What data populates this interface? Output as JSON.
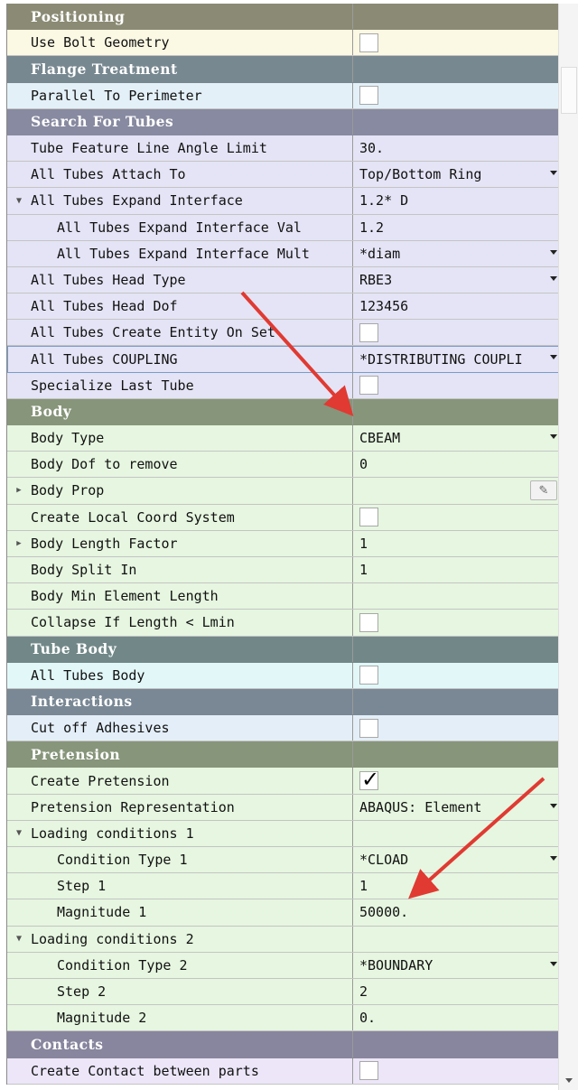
{
  "colors": {
    "positioning": {
      "header": "#8b8b75",
      "row": "#fbf8e3"
    },
    "flange": {
      "header": "#788890",
      "row": "#e3f0f8"
    },
    "search": {
      "header": "#878aa0",
      "row": "#e4e4f6"
    },
    "body": {
      "header": "#87957a",
      "row": "#e6f6e0"
    },
    "tubebody": {
      "header": "#728888",
      "row": "#e2f8f8"
    },
    "interactions": {
      "header": "#7a8895",
      "row": "#e3eef8"
    },
    "pretension": {
      "header": "#87957a",
      "row": "#e6f6e0"
    },
    "contacts": {
      "header": "#88869e",
      "row": "#ece6f8"
    },
    "arrow": "#e03a32"
  },
  "rows": [
    {
      "label": "Positioning",
      "type": "header",
      "group": "positioning"
    },
    {
      "label": "Use Bolt Geometry",
      "group": "positioning",
      "kind": "checkbox",
      "checked": false
    },
    {
      "label": "Flange Treatment",
      "type": "header",
      "group": "flange"
    },
    {
      "label": "Parallel To Perimeter",
      "group": "flange",
      "kind": "checkbox",
      "checked": false
    },
    {
      "label": "Search For Tubes",
      "type": "header",
      "group": "search"
    },
    {
      "label": "Tube Feature Line Angle Limit",
      "group": "search",
      "kind": "text",
      "value": "30."
    },
    {
      "label": "All Tubes Attach To",
      "group": "search",
      "kind": "dropdown",
      "value": "Top/Bottom Ring"
    },
    {
      "label": "All Tubes Expand Interface",
      "group": "search",
      "kind": "text",
      "value": "1.2* D",
      "expander": "expanded"
    },
    {
      "label": "All Tubes Expand Interface Val",
      "group": "search",
      "kind": "text",
      "value": "1.2",
      "indent": true
    },
    {
      "label": "All Tubes Expand Interface Mult",
      "group": "search",
      "kind": "dropdown",
      "value": "*diam",
      "indent": true
    },
    {
      "label": "All Tubes Head Type",
      "group": "search",
      "kind": "dropdown",
      "value": "RBE3"
    },
    {
      "label": "All Tubes Head Dof",
      "group": "search",
      "kind": "text",
      "value": "123456"
    },
    {
      "label": "All Tubes Create Entity On Set",
      "group": "search",
      "kind": "checkbox",
      "checked": false
    },
    {
      "label": "All Tubes COUPLING",
      "group": "search",
      "kind": "dropdown",
      "value": "*DISTRIBUTING COUPLI",
      "selected": true
    },
    {
      "label": "Specialize Last Tube",
      "group": "search",
      "kind": "checkbox",
      "checked": false
    },
    {
      "label": "Body",
      "type": "header",
      "group": "body"
    },
    {
      "label": "Body Type",
      "group": "body",
      "kind": "dropdown",
      "value": "CBEAM"
    },
    {
      "label": "Body Dof to remove",
      "group": "body",
      "kind": "text",
      "value": "0"
    },
    {
      "label": "Body Prop",
      "group": "body",
      "kind": "button",
      "value": "",
      "expander": "collapsed"
    },
    {
      "label": "Create Local Coord System",
      "group": "body",
      "kind": "checkbox",
      "checked": false
    },
    {
      "label": "Body Length Factor",
      "group": "body",
      "kind": "text",
      "value": "1",
      "expander": "collapsed"
    },
    {
      "label": "Body Split In",
      "group": "body",
      "kind": "text",
      "value": "1"
    },
    {
      "label": "Body Min Element Length",
      "group": "body",
      "kind": "text",
      "value": ""
    },
    {
      "label": "Collapse If Length < Lmin",
      "group": "body",
      "kind": "checkbox",
      "checked": false
    },
    {
      "label": "Tube Body",
      "type": "header",
      "group": "tubebody"
    },
    {
      "label": "All Tubes Body",
      "group": "tubebody",
      "kind": "checkbox",
      "checked": false
    },
    {
      "label": "Interactions",
      "type": "header",
      "group": "interactions"
    },
    {
      "label": "Cut off Adhesives",
      "group": "interactions",
      "kind": "checkbox",
      "checked": false
    },
    {
      "label": "Pretension",
      "type": "header",
      "group": "pretension"
    },
    {
      "label": "Create Pretension",
      "group": "pretension",
      "kind": "checkbox",
      "checked": true
    },
    {
      "label": "Pretension Representation",
      "group": "pretension",
      "kind": "dropdown",
      "value": "ABAQUS: Element"
    },
    {
      "label": "Loading conditions 1",
      "group": "pretension",
      "kind": "text",
      "value": "",
      "expander": "expanded"
    },
    {
      "label": "Condition Type 1",
      "group": "pretension",
      "kind": "dropdown",
      "value": "*CLOAD",
      "indent": true
    },
    {
      "label": "Step 1",
      "group": "pretension",
      "kind": "text",
      "value": "1",
      "indent": true
    },
    {
      "label": "Magnitude 1",
      "group": "pretension",
      "kind": "text",
      "value": "50000.",
      "indent": true
    },
    {
      "label": "Loading conditions 2",
      "group": "pretension",
      "kind": "text",
      "value": "",
      "expander": "expanded"
    },
    {
      "label": "Condition Type 2",
      "group": "pretension",
      "kind": "dropdown",
      "value": "*BOUNDARY",
      "indent": true
    },
    {
      "label": "Step 2",
      "group": "pretension",
      "kind": "text",
      "value": "2",
      "indent": true
    },
    {
      "label": "Magnitude 2",
      "group": "pretension",
      "kind": "text",
      "value": "0.",
      "indent": true
    },
    {
      "label": "Contacts",
      "type": "header",
      "group": "contacts"
    },
    {
      "label": "Create Contact between parts",
      "group": "contacts",
      "kind": "checkbox",
      "checked": false
    }
  ],
  "icons": {
    "expanded": "triangle-down-icon",
    "collapsed": "triangle-right-icon",
    "dropdown": "chevron-down-icon",
    "button": "pencil-icon"
  }
}
